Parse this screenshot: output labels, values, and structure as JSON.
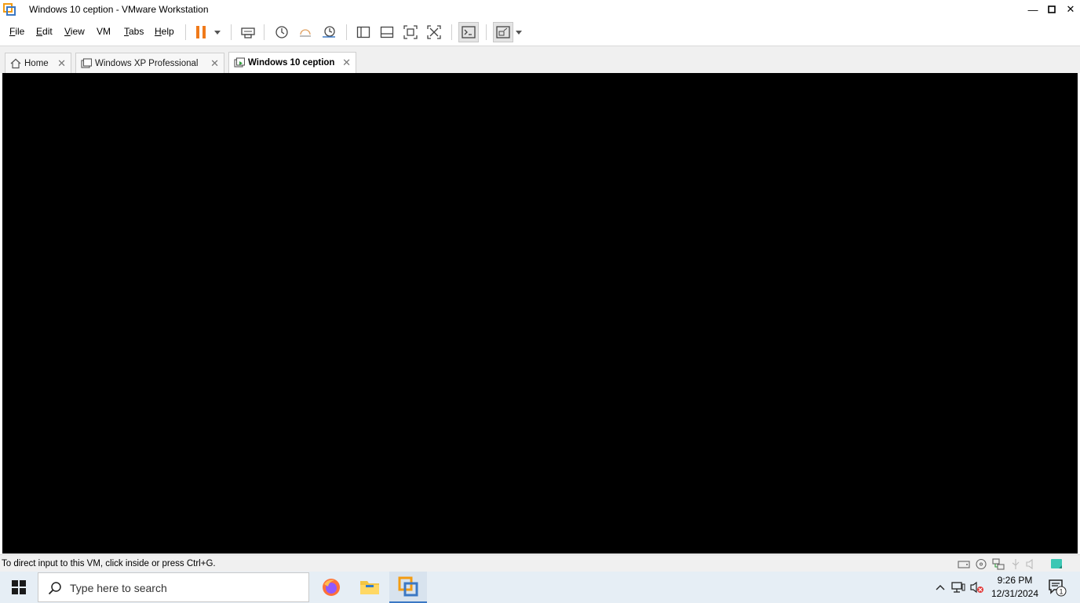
{
  "window": {
    "title": "Windows 10 ception - VMware Workstation",
    "minimize": "—",
    "maximize": "◻",
    "close": "✕"
  },
  "menu": {
    "file": "F",
    "file_rest": "ile",
    "edit": "E",
    "edit_rest": "dit",
    "view": "V",
    "view_rest": "iew",
    "vm": "VM",
    "tabs": "T",
    "tabs_rest": "abs",
    "help": "H",
    "help_rest": "elp"
  },
  "tabs": [
    {
      "label": "Home",
      "close": "✕"
    },
    {
      "label": "Windows XP Professional",
      "close": "✕"
    },
    {
      "label": "Windows 10 ception",
      "close": "✕"
    }
  ],
  "status": {
    "hint": "To direct input to this VM, click inside or press Ctrl+G."
  },
  "taskbar": {
    "search_placeholder": "Type here to search",
    "time": "9:26 PM",
    "date": "12/31/2024",
    "notification_count": "1"
  },
  "colors": {
    "vm_screen": "#000000",
    "pause_orange": "#f07a1a",
    "accent_blue": "#3b78c4",
    "taskbar": "#e6eef5"
  }
}
